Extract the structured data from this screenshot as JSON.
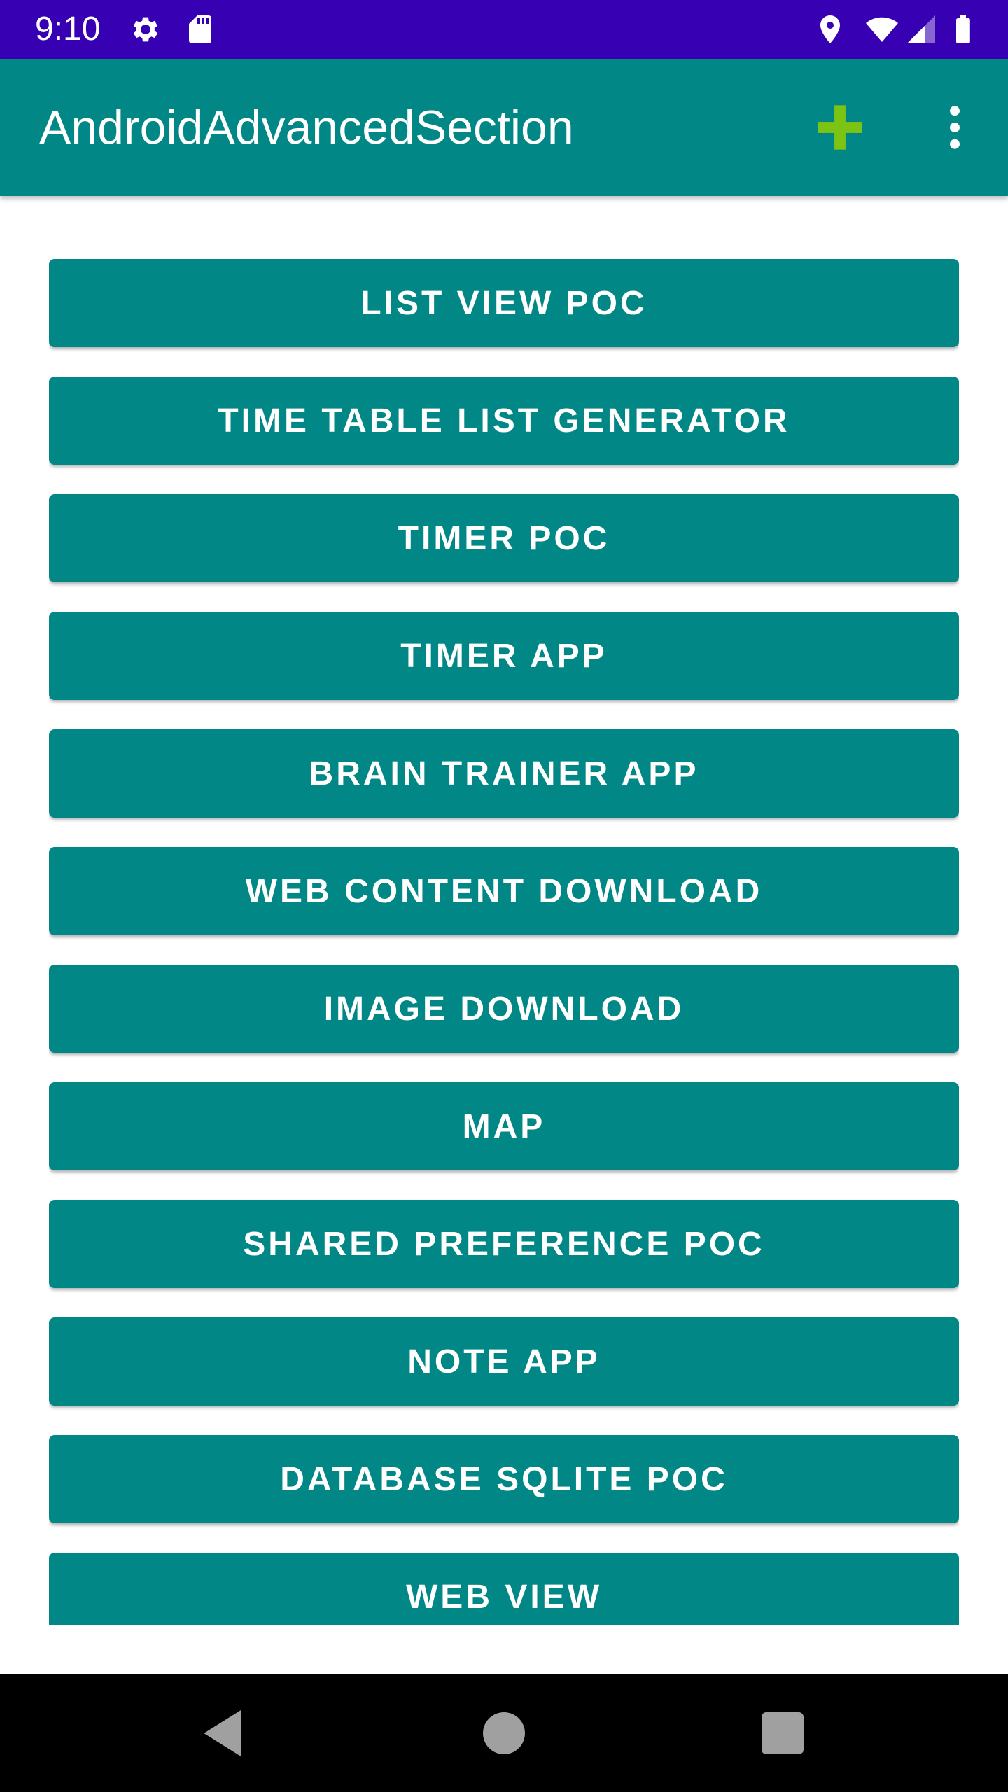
{
  "status_bar": {
    "time": "9:10",
    "left_icons": [
      "gear-icon",
      "sd-card-icon"
    ],
    "right_icons": [
      "location-icon",
      "wifi-icon",
      "signal-icon",
      "battery-icon"
    ],
    "color": "#3700b3"
  },
  "app_bar": {
    "title": "AndroidAdvancedSection",
    "actions": [
      "add-icon",
      "overflow-menu-icon"
    ],
    "color": "#018786",
    "add_icon_color": "#7cc413"
  },
  "buttons": [
    {
      "label": "LIST VIEW POC"
    },
    {
      "label": "TIME TABLE LIST GENERATOR"
    },
    {
      "label": "TIMER POC"
    },
    {
      "label": "TIMER APP"
    },
    {
      "label": "BRAIN TRAINER APP"
    },
    {
      "label": "WEB CONTENT DOWNLOAD"
    },
    {
      "label": "IMAGE DOWNLOAD"
    },
    {
      "label": "MAP"
    },
    {
      "label": "SHARED PREFERENCE POC"
    },
    {
      "label": "NOTE APP"
    },
    {
      "label": "DATABASE SQLITE POC"
    },
    {
      "label": "WEB VIEW"
    }
  ],
  "button_color": "#018786",
  "nav_bar": {
    "icons": [
      "back-icon",
      "home-icon",
      "recents-icon"
    ]
  }
}
